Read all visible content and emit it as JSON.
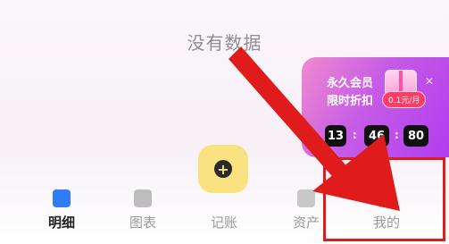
{
  "empty_state": {
    "text": "没有数据"
  },
  "promo": {
    "line1": "永久会员",
    "line2": "限时折扣",
    "price": "0.1元/月",
    "countdown": {
      "hours": "13",
      "minutes": "46",
      "seconds": "80"
    },
    "colors": {
      "gradient_start": "#f08ad0",
      "gradient_end": "#b23cf0",
      "badge": "#ff3b66"
    }
  },
  "add_button": {
    "icon": "plus-icon"
  },
  "nav": {
    "items": [
      {
        "label": "明细",
        "icon": "list-icon",
        "active": true
      },
      {
        "label": "图表",
        "icon": "chart-icon",
        "active": false
      },
      {
        "label": "记账",
        "icon": "plus-icon",
        "active": false
      },
      {
        "label": "资产",
        "icon": "piggy-bank-icon",
        "active": false
      },
      {
        "label": "我的",
        "icon": "user-icon",
        "active": false
      }
    ]
  },
  "annotation": {
    "color": "#e01b1b"
  }
}
